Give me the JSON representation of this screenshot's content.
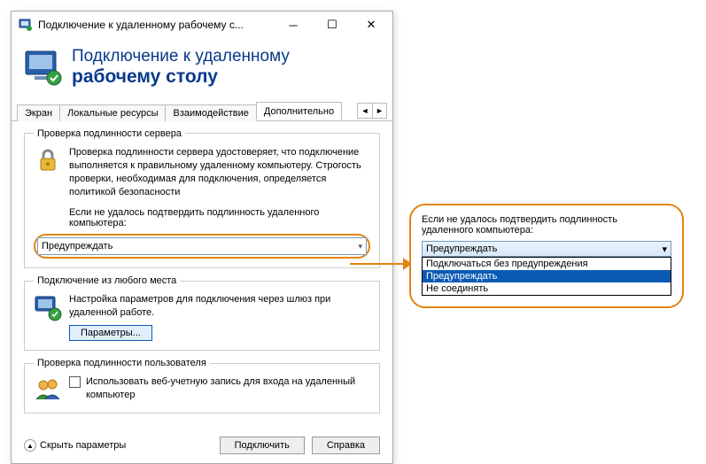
{
  "titlebar": {
    "text": "Подключение к удаленному рабочему с..."
  },
  "header": {
    "line1": "Подключение к удаленному",
    "line2": "рабочему столу"
  },
  "tabs": {
    "t1": "Экран",
    "t2": "Локальные ресурсы",
    "t3": "Взаимодействие",
    "t4": "Дополнительно"
  },
  "group_auth": {
    "legend": "Проверка подлинности сервера",
    "desc": "Проверка подлинности сервера удостоверяет, что подключение выполняется к правильному удаленному компьютеру. Строгость проверки, необходимая для подключения, определяется политикой безопасности",
    "prompt": "Если не удалось подтвердить подлинность удаленного компьютера:",
    "combo_value": "Предупреждать"
  },
  "group_anywhere": {
    "legend": "Подключение из любого места",
    "desc": "Настройка параметров для подключения через шлюз при удаленной работе.",
    "button": "Параметры..."
  },
  "group_userauth": {
    "legend": "Проверка подлинности пользователя",
    "checkbox_label": "Использовать веб-учетную запись для входа на удаленный компьютер"
  },
  "footer": {
    "hide_params": "Скрыть параметры",
    "connect": "Подключить",
    "help": "Справка"
  },
  "callout": {
    "prompt": "Если не удалось подтвердить подлинность удаленного компьютера:",
    "combo_value": "Предупреждать",
    "options": {
      "o1": "Подключаться без предупреждения",
      "o2": "Предупреждать",
      "o3": "Не соединять"
    }
  }
}
